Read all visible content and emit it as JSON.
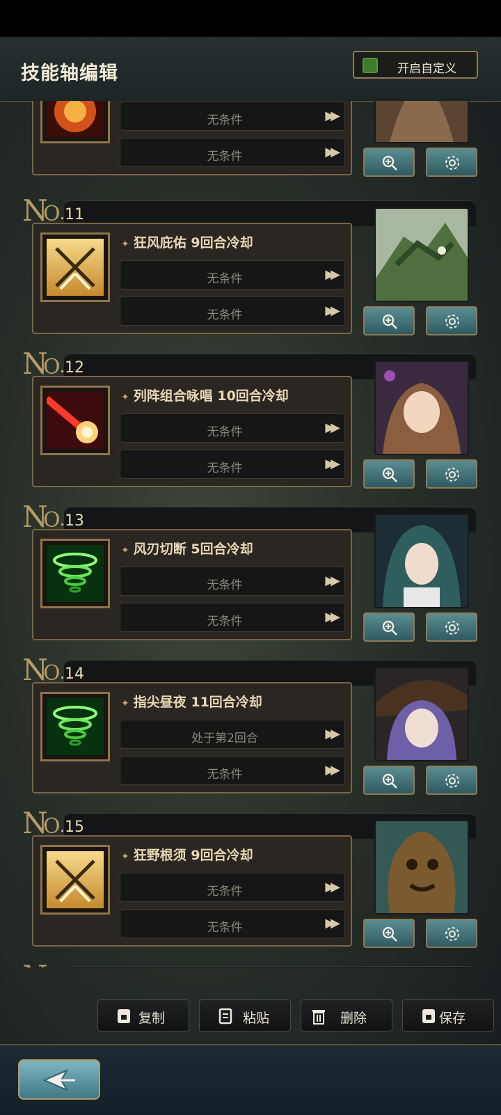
{
  "header": {
    "title": "技能轴编辑",
    "custom_toggle_label": "开启自定义"
  },
  "entries": [
    {
      "no": ".11",
      "skill": "狂风庇佑 9回合冷却",
      "cond1": "无条件",
      "cond2": "无条件",
      "skill_icon": "crossed-swords-gold-icon",
      "portrait": "dragon-portrait"
    },
    {
      "no": ".12",
      "skill": "列阵组合咏唱 10回合冷却",
      "cond1": "无条件",
      "cond2": "无条件",
      "skill_icon": "red-beam-icon",
      "portrait": "witch-girl-portrait"
    },
    {
      "no": ".13",
      "skill": "风刃切断 5回合冷却",
      "cond1": "无条件",
      "cond2": "无条件",
      "skill_icon": "green-tornado-icon",
      "portrait": "teal-hair-girl-portrait"
    },
    {
      "no": ".14",
      "skill": "指尖昼夜 11回合冷却",
      "cond1": "处于第2回合",
      "cond2": "无条件",
      "skill_icon": "green-tornado-icon",
      "portrait": "purple-hair-hat-portrait"
    },
    {
      "no": ".15",
      "skill": "狂野根须 9回合冷却",
      "cond1": "无条件",
      "cond2": "无条件",
      "skill_icon": "crossed-swords-gold-icon",
      "portrait": "tree-monster-portrait"
    }
  ],
  "partial_top": {
    "cond1": "无条件",
    "cond2": "无条件"
  },
  "actions": {
    "copy": "复制",
    "paste": "粘贴",
    "delete": "删除",
    "save": "保存"
  }
}
